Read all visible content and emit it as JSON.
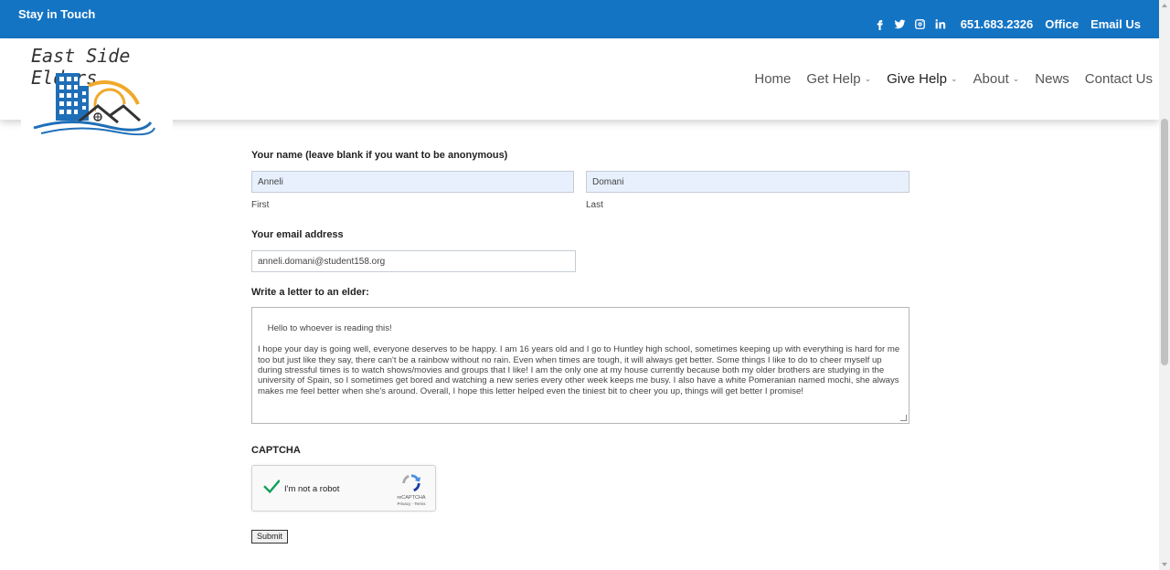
{
  "topbar": {
    "stay_in_touch": "Stay in Touch",
    "social_icons": [
      "facebook-icon",
      "twitter-icon",
      "instagram-icon",
      "linkedin-icon"
    ],
    "phone": "651.683.2326",
    "office": "Office",
    "email": "Email Us",
    "background": "#1474c4"
  },
  "logo": {
    "text": "East Side Elders",
    "colors": {
      "building": "#1f6fb8",
      "sun": "#f0a92b",
      "roof": "#333333"
    }
  },
  "nav": {
    "items": [
      {
        "label": "Home",
        "has_dropdown": false,
        "active": false
      },
      {
        "label": "Get Help",
        "has_dropdown": true,
        "active": false
      },
      {
        "label": "Give Help",
        "has_dropdown": true,
        "active": true
      },
      {
        "label": "About",
        "has_dropdown": true,
        "active": false
      },
      {
        "label": "News",
        "has_dropdown": false,
        "active": false
      },
      {
        "label": "Contact Us",
        "has_dropdown": false,
        "active": false
      }
    ]
  },
  "form": {
    "name_label": "Your name (leave blank if you want to be anonymous)",
    "first_value": "Anneli",
    "first_sublabel": "First",
    "last_value": "Domani",
    "last_sublabel": "Last",
    "email_label": "Your email address",
    "email_value": "anneli.domani@student158.org",
    "letter_label": "Write a letter to an elder:",
    "letter_value": "Hello to whoever is reading this!\n\nI hope your day is going well, everyone deserves to be happy. I am 16 years old and I go to Huntley high school, sometimes keeping up with everything is hard for me too but just like they say, there can't be a rainbow without no rain. Even when times are tough, it will always get better. Some things I like to do to cheer myself up during stressful times is to watch shows/movies and groups that I like! I am the only one at my house currently because both my older brothers are studying in the university of Spain, so I sometimes get bored and watching a new series every other week keeps me busy. I also have a white Pomeranian named mochi, she always makes me feel better when she's around. Overall, I hope this letter helped even the tiniest bit to cheer you up, things will get better I promise!",
    "captcha_label": "CAPTCHA",
    "captcha": {
      "checkbox_text": "I'm not a robot",
      "brand": "reCAPTCHA",
      "terms": "Privacy - Terms",
      "checked": true,
      "check_color": "#0f9d58"
    },
    "submit_label": "Submit"
  }
}
